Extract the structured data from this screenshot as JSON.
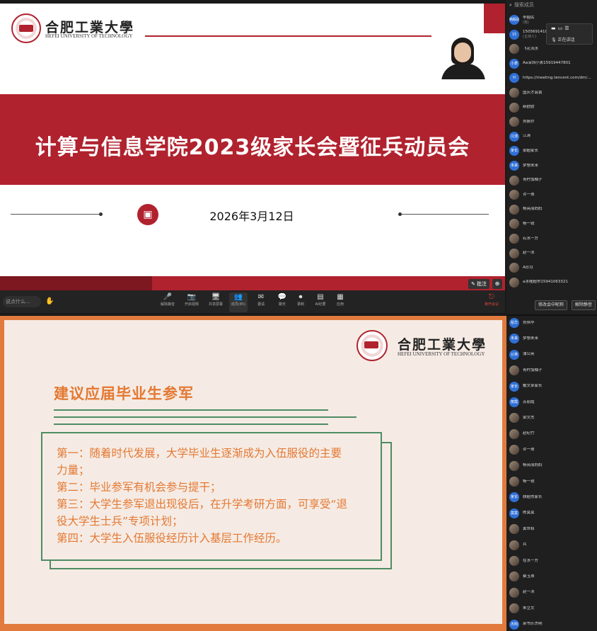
{
  "slide1": {
    "logo_cn": "合肥工業大學",
    "logo_en": "HEFEI UNIVERSITY OF TECHNOLOGY",
    "title": "计算与信息学院2023级家长会暨征兵动员会",
    "date": "2026年3月12日",
    "annotate_label": "批注"
  },
  "toolbar": {
    "search_placeholder": "说点什么...",
    "items": [
      {
        "icon": "🎤",
        "label": "解除静音"
      },
      {
        "icon": "📷",
        "label": "开启视频"
      },
      {
        "icon": "🖥",
        "label": "共享屏幕"
      },
      {
        "icon": "👥",
        "label": "成员(85)"
      },
      {
        "icon": "✉",
        "label": "邀请"
      },
      {
        "icon": "💬",
        "label": "聊天"
      },
      {
        "icon": "⏺",
        "label": "录制"
      },
      {
        "icon": "▤",
        "label": "AI纪要"
      },
      {
        "icon": "▦",
        "label": "应用"
      }
    ],
    "leave_label": "离开会议"
  },
  "slide2": {
    "logo_cn": "合肥工業大學",
    "logo_en": "HEFEI UNIVERSITY OF TECHNOLOGY",
    "heading": "建议应届毕业生参军",
    "lines": [
      "第一：随着时代发展，大学毕业生逐渐成为入伍服役的主要",
      "力量；",
      "第二：毕业参军有机会参与提干；",
      "第三：大学生参军退出现役后，在升学考研方面，可享受“退",
      "役大学生士兵”专项计划；",
      "第四：大学生入伍服役经历计入基层工作经历。"
    ]
  },
  "panel": {
    "search_placeholder": "搜索成员",
    "speaking_text": "正在讲话",
    "members_top": [
      {
        "avatar": "韩毅民",
        "name": "李毅民",
        "sub": "(我)",
        "type": "blue"
      },
      {
        "avatar": "15",
        "name": "15056914105",
        "sub": "(主持人)",
        "type": "blue"
      },
      {
        "avatar": "",
        "name": "飞花流水",
        "sub": "",
        "type": "img"
      },
      {
        "avatar": "小表",
        "name": "Aa深圳小表15919447801",
        "sub": "",
        "type": "blue"
      },
      {
        "avatar": "H",
        "name": "https://meeting.tencent.com/dm/eceMO",
        "sub": "",
        "type": "blue"
      },
      {
        "avatar": "",
        "name": "国庆才会黄",
        "sub": "",
        "type": "img"
      },
      {
        "avatar": "",
        "name": "新欧欧",
        "sub": "",
        "type": "img"
      },
      {
        "avatar": "",
        "name": "刘振乔",
        "sub": "",
        "type": "img"
      },
      {
        "avatar": "江涛",
        "name": "江涛",
        "sub": "",
        "type": "blue"
      },
      {
        "avatar": "家长",
        "name": "梁超家长",
        "sub": "",
        "type": "blue"
      },
      {
        "avatar": "未来",
        "name": "梦想未来",
        "sub": "",
        "type": "blue"
      },
      {
        "avatar": "",
        "name": "青柠加柚子",
        "sub": "",
        "type": "img"
      },
      {
        "avatar": "",
        "name": "许一珠",
        "sub": "",
        "type": "img"
      },
      {
        "avatar": "",
        "name": "杨亮丽妈妈",
        "sub": "",
        "type": "img"
      },
      {
        "avatar": "",
        "name": "杨一锐",
        "sub": "",
        "type": "img"
      },
      {
        "avatar": "",
        "name": "石水一方",
        "sub": "",
        "type": "img"
      },
      {
        "avatar": "",
        "name": "赵一冰",
        "sub": "",
        "type": "img"
      },
      {
        "avatar": "",
        "name": "A珍月",
        "sub": "",
        "type": "img"
      },
      {
        "avatar": "",
        "name": "a冰隆超市15941063321",
        "sub": "",
        "type": "img"
      }
    ],
    "btn_mute_all": "修改会中昵称",
    "btn_unmute": "解除静音",
    "members_bottom": [
      {
        "avatar": "柏华",
        "name": "刘伟华",
        "type": "blue"
      },
      {
        "avatar": "未来",
        "name": "梦想未来",
        "type": "blue"
      },
      {
        "avatar": "公英",
        "name": "蒲公英",
        "type": "blue"
      },
      {
        "avatar": "",
        "name": "青柠加柚子",
        "type": "img"
      },
      {
        "avatar": "家长",
        "name": "戴文卓家长",
        "type": "blue"
      },
      {
        "avatar": "丽霞",
        "name": "苏丽霞",
        "type": "blue"
      },
      {
        "avatar": "",
        "name": "梁文杰",
        "type": "img"
      },
      {
        "avatar": "",
        "name": "赵纪竹",
        "type": "img"
      },
      {
        "avatar": "",
        "name": "许一珠",
        "type": "img"
      },
      {
        "avatar": "",
        "name": "杨亮丽妈妈",
        "type": "img"
      },
      {
        "avatar": "",
        "name": "杨一锐",
        "type": "img"
      },
      {
        "avatar": "家长",
        "name": "顾超然家长",
        "type": "blue"
      },
      {
        "avatar": "莫莫",
        "name": "陈莫莫",
        "type": "blue"
      },
      {
        "avatar": "",
        "name": "黄世和",
        "type": "img"
      },
      {
        "avatar": "",
        "name": "兵",
        "type": "img"
      },
      {
        "avatar": "",
        "name": "在水一方",
        "type": "img"
      },
      {
        "avatar": "",
        "name": "蔡玉珠",
        "type": "img"
      },
      {
        "avatar": "",
        "name": "赵一冰",
        "type": "img"
      },
      {
        "avatar": "",
        "name": "朱立文",
        "type": "img"
      },
      {
        "avatar": "杰明",
        "name": "余书乐杰明",
        "type": "blue"
      }
    ]
  }
}
